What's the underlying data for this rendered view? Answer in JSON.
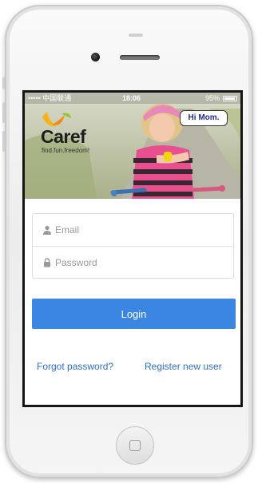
{
  "status_bar": {
    "carrier": "••••• 中国联通 ",
    "time": "18:06",
    "battery": "95%",
    "battery_level": 0.95
  },
  "brand": {
    "name": "Caref",
    "tagline": "find.fun.freedom!",
    "logo_icon": "petal-logo-icon",
    "logo_colors": [
      "#f6b21a",
      "#f28a1c",
      "#9ac33c"
    ]
  },
  "hero": {
    "speech_bubble": "Hi Mom."
  },
  "form": {
    "email_placeholder": "Email",
    "password_placeholder": "Password",
    "login_label": "Login"
  },
  "links": {
    "forgot": "Forgot password?",
    "register": "Register new user"
  },
  "colors": {
    "accent": "#3b86e3",
    "link": "#2d6fc9"
  }
}
